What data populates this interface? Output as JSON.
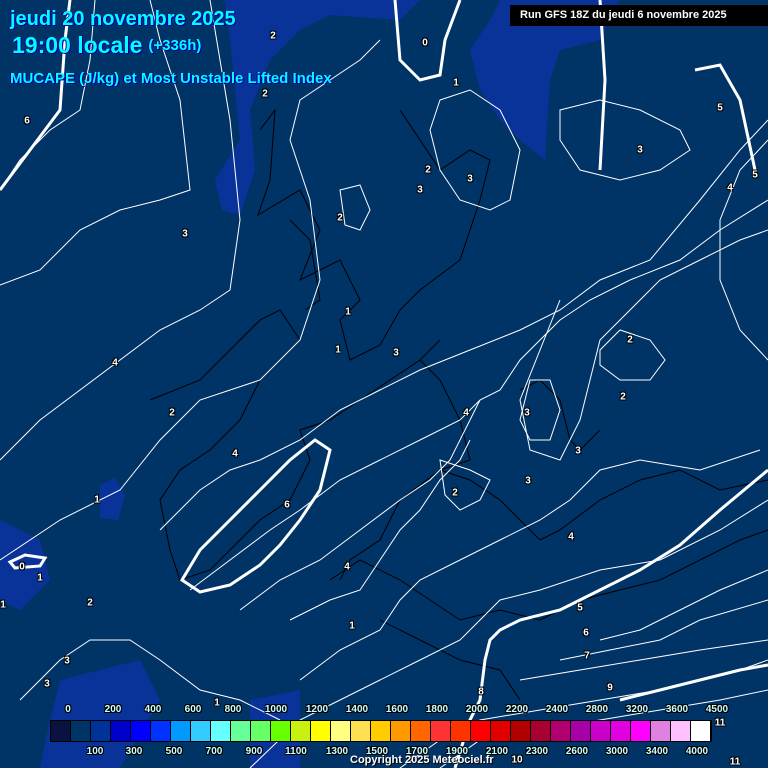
{
  "header": {
    "date": "jeudi 20 novembre 2025",
    "time": "19:00 locale",
    "lead": "(+336h)",
    "parameter": "MUCAPE (J/kg) et Most Unstable Lifted Index",
    "run": "Run GFS 18Z du jeudi 6 novembre 2025"
  },
  "colors": {
    "background": "#003366",
    "contour": "#ffffff",
    "title": "#00ffff"
  },
  "legend": {
    "unit": "J/kg",
    "top_ticks": [
      "0",
      "200",
      "400",
      "600",
      "800",
      "1000",
      "1200",
      "1400",
      "1600",
      "1800",
      "2000",
      "2200",
      "2400",
      "2800",
      "3200",
      "3600",
      "4500"
    ],
    "bottom_ticks": [
      "100",
      "300",
      "500",
      "700",
      "900",
      "1100",
      "1300",
      "1500",
      "1700",
      "1900",
      "2100",
      "2300",
      "2600",
      "3000",
      "3400",
      "4000"
    ],
    "swatches": [
      "#0a1240",
      "#003366",
      "#003399",
      "#0000cc",
      "#0000ff",
      "#0033ff",
      "#0099ff",
      "#33ccff",
      "#66ffff",
      "#66ff99",
      "#66ff66",
      "#66ff00",
      "#c8f010",
      "#ffff00",
      "#ffff80",
      "#ffe050",
      "#ffcc00",
      "#ff9900",
      "#ff6600",
      "#ff3333",
      "#ff3300",
      "#ff0000",
      "#e00000",
      "#b00000",
      "#a80030",
      "#b00070",
      "#a800a8",
      "#c800c8",
      "#e000e0",
      "#ff00ff",
      "#e080e0",
      "#ffc0ff",
      "#ffffff"
    ]
  },
  "contour_labels": [
    "2",
    "0",
    "1",
    "2",
    "6",
    "3",
    "3",
    "3",
    "2",
    "5",
    "2",
    "4",
    "5",
    "3",
    "4",
    "1",
    "1",
    "3",
    "2",
    "4",
    "2",
    "4",
    "3",
    "2",
    "3",
    "3",
    "6",
    "4",
    "1",
    "1",
    "4",
    "2",
    "0",
    "1",
    "2",
    "5",
    "6",
    "7",
    "9",
    "8",
    "10",
    "11",
    "11",
    "1",
    "3",
    "3",
    "1"
  ],
  "copyright": "Copyright 2025 Meteociel.fr"
}
